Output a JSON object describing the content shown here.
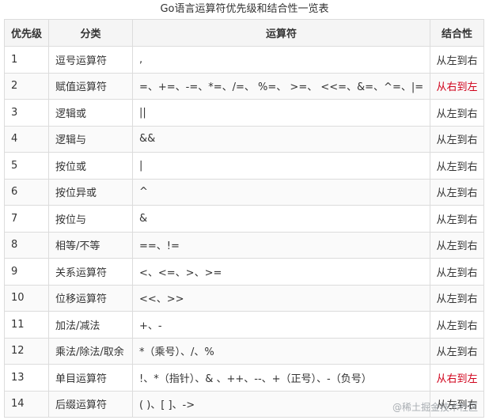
{
  "caption": "Go语言运算符优先级和结合性一览表",
  "headers": [
    "优先级",
    "分类",
    "运算符",
    "结合性"
  ],
  "rows": [
    [
      "1",
      "逗号运算符",
      ",",
      "从左到右"
    ],
    [
      "2",
      "赋值运算符",
      "=、+=、-=、*=、/=、 %=、 >=、 <<=、&=、^=、|=",
      "从右到左"
    ],
    [
      "3",
      "逻辑或",
      "||",
      "从左到右"
    ],
    [
      "4",
      "逻辑与",
      "&&",
      "从左到右"
    ],
    [
      "5",
      "按位或",
      "|",
      "从左到右"
    ],
    [
      "6",
      "按位异或",
      "^",
      "从左到右"
    ],
    [
      "7",
      "按位与",
      "&",
      "从左到右"
    ],
    [
      "8",
      "相等/不等",
      "==、!=",
      "从左到右"
    ],
    [
      "9",
      "关系运算符",
      "<、<=、>、>=",
      "从左到右"
    ],
    [
      "10",
      "位移运算符",
      "<<、>>",
      "从左到右"
    ],
    [
      "11",
      "加法/减法",
      "+、-",
      "从左到右"
    ],
    [
      "12",
      "乘法/除法/取余",
      "*（乘号）、/、%",
      "从左到右"
    ],
    [
      "13",
      "单目运算符",
      "!、*（指针）、& 、++、--、+（正号）、-（负号）",
      "从右到左"
    ],
    [
      "14",
      "后缀运算符",
      "( )、[ ]、->",
      "从左到右"
    ]
  ],
  "colors": {
    "right_to_left": "#d0021b"
  },
  "watermark": "@稀土掘金技术社区"
}
